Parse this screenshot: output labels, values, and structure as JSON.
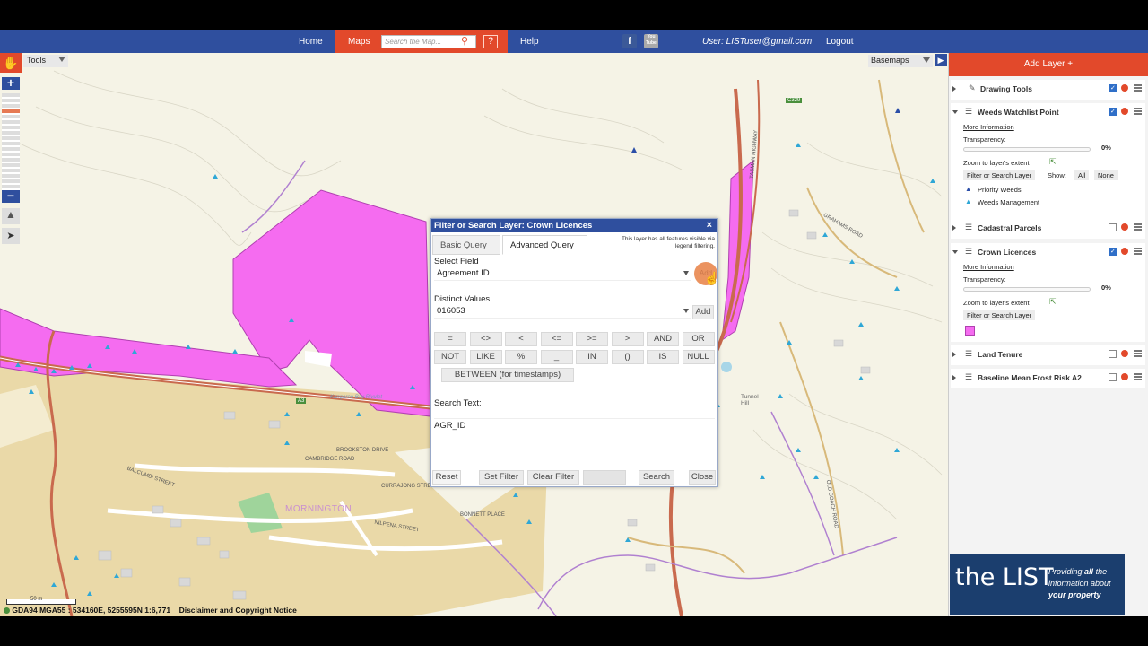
{
  "nav": {
    "home": "Home",
    "maps": "Maps",
    "search_placeholder": "Search the Map...",
    "help_glyph": "?",
    "help": "Help",
    "facebook_glyph": "f",
    "youtube_glyph": "You Tube",
    "user": "User: LISTuser@gmail.com",
    "logout": "Logout"
  },
  "map": {
    "tools": "Tools",
    "basemaps": "Basemaps",
    "status": "GDA94 MGA55 : 534160E, 5255595N 1:6,771",
    "disclaimer": "Disclaimer and Copyright Notice",
    "scale_label": "50 m",
    "labels": {
      "mornington": "MORNINGTON",
      "balcumbi": "BALCUMBI STREET",
      "cambridge": "CAMBRIDGE ROAD",
      "brookston": "BROOKSTON DRIVE",
      "currajong": "CURRAJONG STREET",
      "nilpena": "NILPENA STREET",
      "bonnett": "BONNETT PLACE",
      "tunnel": "Tunnel Hill",
      "grahams": "GRAHAMS ROAD",
      "tasman": "TASMAN HIGHWAY",
      "kangaroo": "Kangaroo Bay Rivulet",
      "coach": "OLD COACH ROAD",
      "a3": "A3",
      "c329": "C329"
    }
  },
  "dialog": {
    "title": "Filter or Search Layer: Crown Licences",
    "close": "×",
    "tab_basic": "Basic Query",
    "tab_advanced": "Advanced Query",
    "note": "This layer has all features visible via legend filtering.",
    "select_field_label": "Select Field",
    "select_field_value": "Agreement ID",
    "add_field": "Add",
    "distinct_label": "Distinct Values",
    "distinct_value": "016053",
    "add_value": "Add",
    "ops_row1": [
      "=",
      "<>",
      "<",
      "<=",
      ">=",
      ">",
      "AND",
      "OR"
    ],
    "ops_row2": [
      "NOT",
      "LIKE",
      "%",
      "_",
      "IN",
      "()",
      "IS",
      "NULL"
    ],
    "between": "BETWEEN (for timestamps)",
    "search_text_label": "Search Text:",
    "search_text_value": "AGR_ID",
    "btn_reset": "Reset",
    "btn_set_filter": "Set Filter",
    "btn_clear_filter": "Clear Filter",
    "btn_search": "Search",
    "btn_close": "Close"
  },
  "panel": {
    "add_layer": "Add Layer +",
    "drawing_tools": "Drawing Tools",
    "weeds": "Weeds Watchlist Point",
    "more_info": "More Information",
    "transparency": "Transparency:",
    "zero_pct": "0%",
    "zoom_extent": "Zoom to layer's extent",
    "filter_btn": "Filter or Search Layer",
    "show": "Show:",
    "all": "All",
    "none": "None",
    "priority_weeds": "Priority Weeds",
    "weeds_mgmt": "Weeds Management",
    "cadastral": "Cadastral Parcels",
    "crown": "Crown Licences",
    "land_tenure": "Land Tenure",
    "frost": "Baseline Mean Frost Risk A2",
    "brand_logo": "the LIST",
    "brand_tag1": "Providing",
    "brand_tag1b": "all",
    "brand_tag1c": "the",
    "brand_tag2": "information about",
    "brand_tag3": "your property"
  },
  "colors": {
    "nav_blue": "#2f4f9e",
    "accent_orange": "#e2492b",
    "crown_licence_magenta": "#f56cf0",
    "residential_tan": "#ead9a8",
    "weed_marker": "#2fa7d6"
  }
}
